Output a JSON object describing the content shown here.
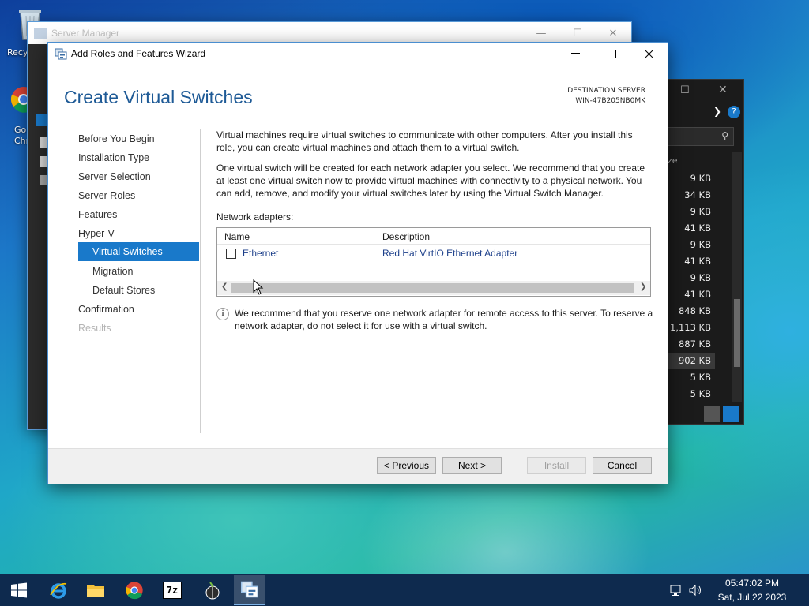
{
  "desktop": {
    "recycle_label": "Recy",
    "chrome_label_1": "Go",
    "chrome_label_2": "Chr"
  },
  "bg_server_manager": {
    "title": "Server Manager"
  },
  "bg_explorer": {
    "column_header": "ze",
    "sizes": [
      "9 KB",
      "34 KB",
      "9 KB",
      "41 KB",
      "9 KB",
      "41 KB",
      "9 KB",
      "41 KB",
      "848 KB",
      "1,113 KB",
      "887 KB",
      "902 KB",
      "5 KB",
      "5 KB"
    ]
  },
  "wizard": {
    "window_title": "Add Roles and Features Wizard",
    "page_title": "Create Virtual Switches",
    "destination_label": "DESTINATION SERVER",
    "destination_value": "WIN-47B205NB0MK",
    "nav": {
      "before": "Before You Begin",
      "installation_type": "Installation Type",
      "server_selection": "Server Selection",
      "server_roles": "Server Roles",
      "features": "Features",
      "hyperv": "Hyper-V",
      "virtual_switches": "Virtual Switches",
      "migration": "Migration",
      "default_stores": "Default Stores",
      "confirmation": "Confirmation",
      "results": "Results"
    },
    "para1": "Virtual machines require virtual switches to communicate with other computers. After you install this role, you can create virtual machines and attach them to a virtual switch.",
    "para2": "One virtual switch will be created for each network adapter you select. We recommend that you create at least one virtual switch now to provide virtual machines with connectivity to a physical network. You can add, remove, and modify your virtual switches later by using the Virtual Switch Manager.",
    "adapters_label": "Network adapters:",
    "table": {
      "col_name": "Name",
      "col_description": "Description",
      "rows": [
        {
          "name": "Ethernet",
          "description": "Red Hat VirtIO Ethernet Adapter",
          "checked": false
        }
      ]
    },
    "info_text": "We recommend that you reserve one network adapter for remote access to this server. To reserve a network adapter, do not select it for use with a virtual switch.",
    "buttons": {
      "previous": "< Previous",
      "next": "Next >",
      "install": "Install",
      "cancel": "Cancel"
    }
  },
  "taskbar": {
    "time": "05:47:02 PM",
    "date": "Sat, Jul 22 2023",
    "sevenzip_label": "7z"
  },
  "colors": {
    "accent": "#0078d7",
    "nav_selected": "#1979ca",
    "title_blue": "#1e5a96",
    "link_blue": "#1c3f8a",
    "taskbar": "#0e2a4e"
  }
}
